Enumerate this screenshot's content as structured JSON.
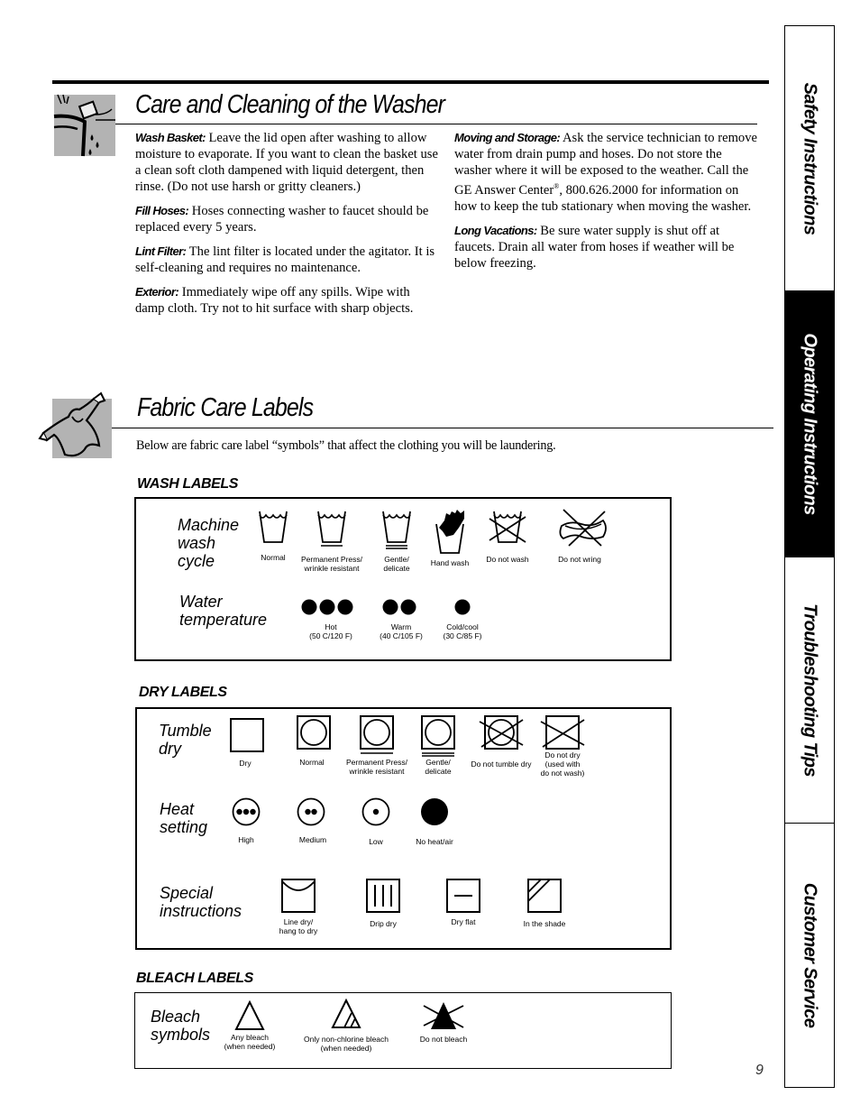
{
  "care_section": {
    "title": "Care and Cleaning of the Washer",
    "icon": "washer-cleaning-icon",
    "left_column": [
      {
        "term": "Wash Basket:",
        "text": " Leave the lid open after washing to allow moisture to evaporate. If you want to clean the basket use a clean soft cloth dampened with liquid detergent, then rinse. (Do not use harsh or gritty cleaners.)"
      },
      {
        "term": "Fill Hoses:",
        "text": " Hoses connecting washer to faucet should be replaced every 5 years."
      },
      {
        "term": "Lint Filter:",
        "text": " The lint filter is located under the agitator. It is self-cleaning and requires no maintenance."
      },
      {
        "term": "Exterior:",
        "text": " Immediately wipe off any spills. Wipe with damp cloth. Try not to hit surface with sharp objects."
      }
    ],
    "right_column": [
      {
        "term": "Moving and Storage:",
        "text_before": " Ask the service technician to remove water from drain pump and hoses. Do not store the washer where it will be exposed to the weather. Call the GE Answer Center",
        "sup": "®",
        "text_after": ", 800.626.2000 for information on how to keep the tub stationary when moving the washer."
      },
      {
        "term": "Long Vacations:",
        "text": " Be sure water supply is shut off at faucets. Drain all water from hoses if weather will be below freezing."
      }
    ]
  },
  "fabric_section": {
    "title": "Fabric Care Labels",
    "icon": "clothing-icon",
    "intro": "Below are fabric care label “symbols” that affect the clothing you will be laundering.",
    "wash": {
      "heading": "WASH LABELS",
      "machine_label": "Machine\nwash\ncycle",
      "machine_items": [
        {
          "caption": "Normal",
          "icon": "wash-tub-normal-icon"
        },
        {
          "caption": "Permanent Press/\nwrinkle resistant",
          "icon": "wash-tub-permanent-press-icon"
        },
        {
          "caption": "Gentle/\ndelicate",
          "icon": "wash-tub-gentle-icon"
        },
        {
          "caption": "Hand wash",
          "icon": "hand-wash-icon"
        },
        {
          "caption": "Do not wash",
          "icon": "do-not-wash-icon"
        },
        {
          "caption": "Do not wring",
          "icon": "do-not-wring-icon"
        }
      ],
      "temp_label": "Water\ntemperature",
      "temp_items": [
        {
          "caption": "Hot\n(50 C/120 F)",
          "dots": 3,
          "icon": "hot-water-dots-icon"
        },
        {
          "caption": "Warm\n(40 C/105 F)",
          "dots": 2,
          "icon": "warm-water-dots-icon"
        },
        {
          "caption": "Cold/cool\n(30 C/85 F)",
          "dots": 1,
          "icon": "cold-water-dot-icon"
        }
      ]
    },
    "dry": {
      "heading": "DRY LABELS",
      "tumble_label": "Tumble\ndry",
      "tumble_items": [
        {
          "caption": "Dry",
          "icon": "dry-square-icon"
        },
        {
          "caption": "Normal",
          "icon": "tumble-dry-normal-icon"
        },
        {
          "caption": "Permanent Press/\nwrinkle resistant",
          "icon": "tumble-dry-permanent-press-icon"
        },
        {
          "caption": "Gentle/\ndelicate",
          "icon": "tumble-dry-gentle-icon"
        },
        {
          "caption": "Do not tumble dry",
          "icon": "do-not-tumble-dry-icon"
        },
        {
          "caption": "Do not dry\n(used with\ndo not wash)",
          "icon": "do-not-dry-icon"
        }
      ],
      "heat_label": "Heat\nsetting",
      "heat_items": [
        {
          "caption": "High",
          "dots": 3,
          "icon": "heat-high-icon"
        },
        {
          "caption": "Medium",
          "dots": 2,
          "icon": "heat-medium-icon"
        },
        {
          "caption": "Low",
          "dots": 1,
          "icon": "heat-low-icon"
        },
        {
          "caption": "No heat/air",
          "dots": 0,
          "icon": "no-heat-icon"
        }
      ],
      "special_label": "Special\ninstructions",
      "special_items": [
        {
          "caption": "Line dry/\nhang to dry",
          "icon": "line-dry-icon"
        },
        {
          "caption": "Drip dry",
          "icon": "drip-dry-icon"
        },
        {
          "caption": "Dry flat",
          "icon": "dry-flat-icon"
        },
        {
          "caption": "In the shade",
          "icon": "dry-in-shade-icon"
        }
      ]
    },
    "bleach": {
      "heading": "BLEACH LABELS",
      "label": "Bleach\nsymbols",
      "items": [
        {
          "caption": "Any bleach\n(when needed)",
          "icon": "any-bleach-icon"
        },
        {
          "caption": "Only non-chlorine bleach\n(when needed)",
          "icon": "non-chlorine-bleach-icon"
        },
        {
          "caption": "Do not bleach",
          "icon": "do-not-bleach-icon"
        }
      ]
    }
  },
  "side_tabs": [
    {
      "label": "Safety Instructions",
      "active": false
    },
    {
      "label": "Operating Instructions",
      "active": true
    },
    {
      "label": "Troubleshooting Tips",
      "active": false
    },
    {
      "label": "Customer Service",
      "active": false
    }
  ],
  "page_number": "9"
}
